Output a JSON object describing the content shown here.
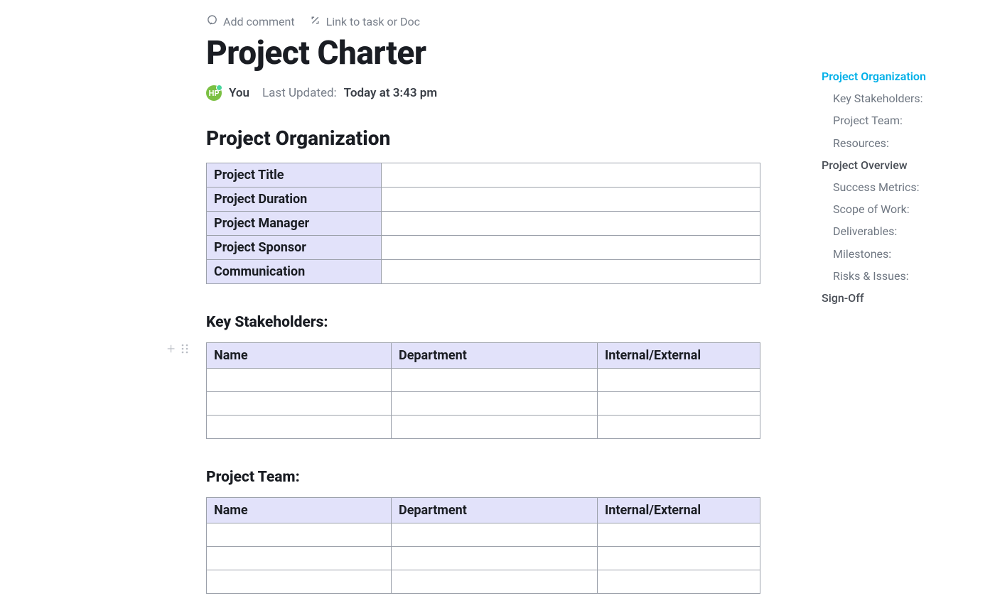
{
  "toolbar": {
    "add_comment": "Add comment",
    "link_task": "Link to task or Doc"
  },
  "doc": {
    "title": "Project Charter",
    "avatar_initials": "HP",
    "author_label": "You",
    "updated_label": "Last Updated:",
    "updated_value": "Today at 3:43 pm"
  },
  "sections": {
    "project_org_heading": "Project Organization",
    "stakeholders_heading": "Key Stakeholders:",
    "team_heading": "Project Team:"
  },
  "project_org_rows": [
    "Project Title",
    "Project Duration",
    "Project Manager",
    "Project Sponsor",
    "Communication"
  ],
  "stakeholders_columns": [
    "Name",
    "Department",
    "Internal/External"
  ],
  "team_columns": [
    "Name",
    "Department",
    "Internal/External"
  ],
  "outline": {
    "project_org": "Project Organization",
    "key_stakeholders": "Key Stakeholders:",
    "project_team": "Project Team:",
    "resources": "Resources:",
    "project_overview": "Project Overview",
    "success_metrics": "Success Metrics:",
    "scope_of_work": "Scope of Work:",
    "deliverables": "Deliverables:",
    "milestones": "Milestones:",
    "risks_issues": "Risks & Issues:",
    "signoff": "Sign-Off"
  }
}
